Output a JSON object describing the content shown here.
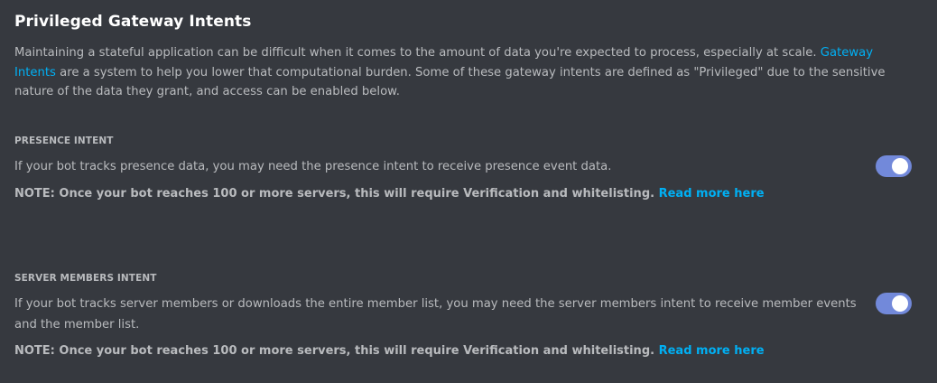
{
  "section": {
    "title": "Privileged Gateway Intents",
    "intro_before_link": "Maintaining a stateful application can be difficult when it comes to the amount of data you're expected to process, especially at scale. ",
    "intro_link": "Gateway Intents",
    "intro_after_link": " are a system to help you lower that computational burden. Some of these gateway intents are defined as \"Privileged\" due to the sensitive nature of the data they grant, and access can be enabled below."
  },
  "intents": [
    {
      "label": "PRESENCE INTENT",
      "description": "If your bot tracks presence data, you may need the presence intent to receive presence event data.",
      "note": "NOTE: Once your bot reaches 100 or more servers, this will require Verification and whitelisting.",
      "note_link": "Read more here",
      "enabled": true
    },
    {
      "label": "SERVER MEMBERS INTENT",
      "description": "If your bot tracks server members or downloads the entire member list, you may need the server members intent to receive member events and the member list.",
      "note": "NOTE: Once your bot reaches 100 or more servers, this will require Verification and whitelisting.",
      "note_link": "Read more here",
      "enabled": true
    }
  ],
  "colors": {
    "background": "#36393f",
    "heading": "#ffffff",
    "text": "#b9bbbe",
    "link": "#00b0f4",
    "toggle_on": "#7289da"
  }
}
